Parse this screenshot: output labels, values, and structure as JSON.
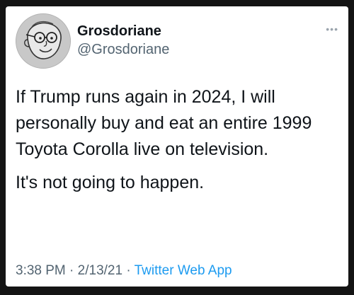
{
  "tweet": {
    "display_name": "Grosdoriane",
    "handle": "@Grosdoriane",
    "more_icon": "ellipsis-icon",
    "paragraphs": [
      "If Trump runs again in 2024, I will personally buy and eat an entire 1999 Toyota Corolla live on television.",
      "It's not going to happen."
    ],
    "time": "3:38 PM",
    "separator": "·",
    "date": "2/13/21",
    "source": "Twitter Web App"
  },
  "colors": {
    "text": "#0f1419",
    "secondary": "#536471",
    "link": "#1d9bf0",
    "background": "#ffffff"
  }
}
